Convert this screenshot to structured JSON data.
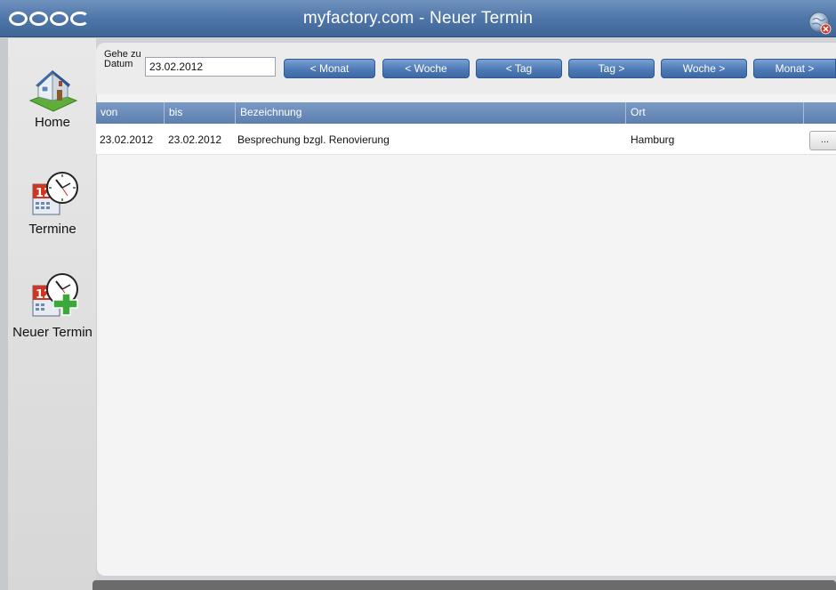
{
  "window": {
    "title": "myfactory.com - Neuer Termin"
  },
  "sidebar": {
    "items": [
      {
        "label": "Home",
        "icon": "house-icon"
      },
      {
        "label": "Termine",
        "icon": "calendar-clock-icon"
      },
      {
        "label": "Neuer Termin",
        "icon": "calendar-clock-add-icon"
      }
    ]
  },
  "toolbar": {
    "goto_label": "Gehe zu Datum",
    "date_value": "23.02.2012",
    "buttons": [
      "< Monat",
      "< Woche",
      "< Tag",
      "Tag >",
      "Woche >",
      "Monat >"
    ]
  },
  "table": {
    "columns": [
      "von",
      "bis",
      "Bezeichnung",
      "Ort",
      ""
    ],
    "rows": [
      {
        "von": "23.02.2012",
        "bis": "23.02.2012",
        "bezeichnung": "Besprechung bzgl. Renovierung",
        "ort": "Hamburg",
        "action": "..."
      }
    ]
  },
  "colors": {
    "titlebar": "#4f76a8",
    "button": "#4e7ab6",
    "table_header": "#6a8bba"
  }
}
